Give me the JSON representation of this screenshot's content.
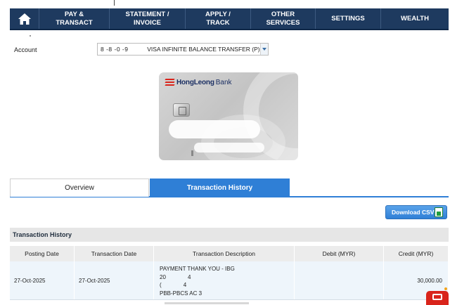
{
  "nav": {
    "home_icon": "home-icon",
    "items": [
      {
        "label": "PAY &\nTRANSACT"
      },
      {
        "label": "STATEMENT /\nINVOICE"
      },
      {
        "label": "APPLY /\nTRACK"
      },
      {
        "label": "OTHER\nSERVICES"
      },
      {
        "label": "SETTINGS"
      },
      {
        "label": "WEALTH"
      }
    ],
    "colors": {
      "background": "#1e3a5f",
      "text": "#ffffff"
    }
  },
  "account": {
    "label": "Account",
    "number": "8   -8   -0   -9",
    "name": "VISA INFINITE BALANCE TRANSFER (P)"
  },
  "card": {
    "brand": "HongLeong",
    "bank": "Bank"
  },
  "tabs": [
    {
      "label": "Overview",
      "active": false
    },
    {
      "label": "Transaction History",
      "active": true
    }
  ],
  "download_button": {
    "label": "Download CSV",
    "icon": "csv-file-icon",
    "color": "#2f7fd6"
  },
  "section_title": "Transaction History",
  "table": {
    "headers": [
      "Posting Date",
      "Transaction Date",
      "Transaction Description",
      "Debit (MYR)",
      "Credit (MYR)"
    ],
    "rows": [
      {
        "posting_date": "27-Oct-2025",
        "transaction_date": "27-Oct-2025",
        "description": [
          "PAYMENT THANK YOU - IBG",
          "20              4",
          "(              4",
          "PBB-PBCS AC 3"
        ],
        "debit": "",
        "credit": "30,000.00"
      }
    ]
  },
  "chat_icon": "chat-icon"
}
